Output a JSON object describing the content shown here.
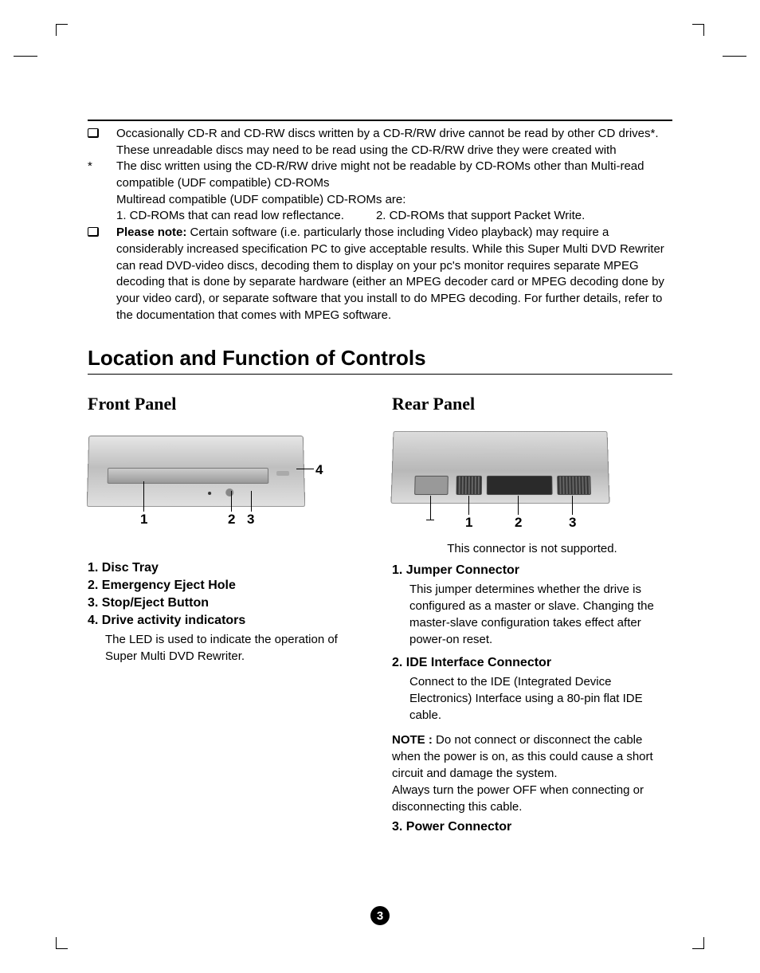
{
  "bullets": [
    {
      "marker": "box",
      "lines": [
        "Occasionally CD-R and CD-RW discs written by a CD-R/RW drive cannot be read by other CD drives*. These unreadable discs may need to be read using the CD-R/RW drive they were created with"
      ]
    },
    {
      "marker": "*",
      "lines": [
        "The disc written using the CD-R/RW drive might not be readable by CD-ROMs other than Multi-read compatible (UDF compatible) CD-ROMs",
        "Multiread compatible (UDF compatible) CD-ROMs are:"
      ],
      "sub_two_col": [
        "1. CD-ROMs that can read low reflectance.",
        "2. CD-ROMs that support Packet Write."
      ]
    },
    {
      "marker": "box",
      "note_label": "Please note:",
      "lines": [
        "Certain software (i.e. particularly those including Video playback) may require a considerably increased specification PC to give acceptable results. While this Super Multi DVD Rewriter can read DVD-video discs, decoding them to display on your pc's monitor requires separate MPEG decoding that is done by separate hardware (either an MPEG decoder card or MPEG decoding done by your video card), or separate software that you install to do MPEG decoding. For further details, refer to the documentation that comes with MPEG software."
      ]
    }
  ],
  "section_title": "Location and Function of Controls",
  "front": {
    "heading": "Front Panel",
    "callouts": {
      "n1": "1",
      "n2": "2",
      "n3": "3",
      "n4": "4"
    },
    "items": [
      {
        "title": "1. Disc Tray"
      },
      {
        "title": "2. Emergency Eject Hole"
      },
      {
        "title": "3. Stop/Eject Button"
      },
      {
        "title": "4. Drive activity indicators",
        "body": "The LED is used to indicate the operation of Super Multi DVD Rewriter."
      }
    ]
  },
  "rear": {
    "heading": "Rear Panel",
    "caption": "This connector is not supported.",
    "callouts": {
      "n1": "1",
      "n2": "2",
      "n3": "3"
    },
    "items": [
      {
        "title": "1. Jumper Connector",
        "body": "This jumper determines whether the drive is configured as a master or slave. Changing the master-slave configuration takes effect after power-on reset."
      },
      {
        "title": "2. IDE Interface Connector",
        "body": "Connect to the IDE (Integrated Device Electronics) Interface using a 80-pin flat IDE cable."
      }
    ],
    "note_label": "NOTE :",
    "note_body": "Do not connect or disconnect the cable when the power is on, as this could cause a short circuit and damage the system.\nAlways turn the power OFF when connecting or disconnecting this cable.",
    "item3_title": "3. Power Connector"
  },
  "page_number": "3"
}
